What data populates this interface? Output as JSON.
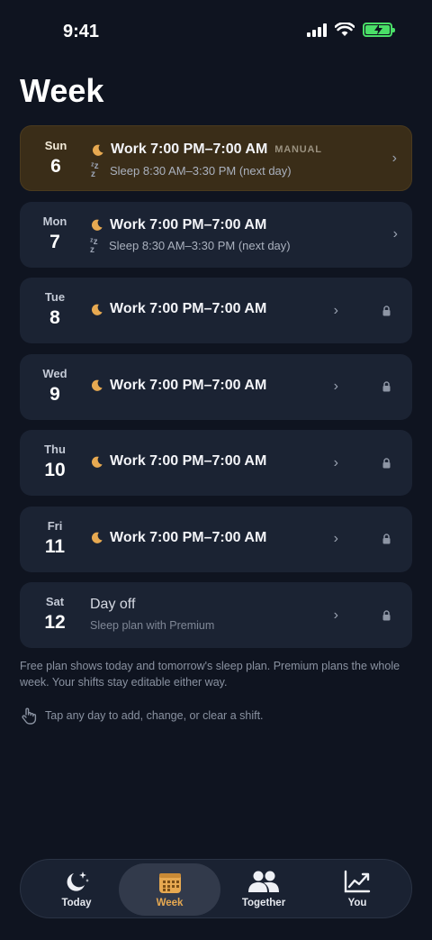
{
  "status": {
    "time": "9:41"
  },
  "page": {
    "title": "Week"
  },
  "days": [
    {
      "dow": "Sun",
      "date": "6",
      "shift": "Work 7:00 PM–7:00 AM",
      "badge": "MANUAL",
      "sleep": "Sleep 8:30 AM–3:30 PM (next day)",
      "locked": false,
      "today": true
    },
    {
      "dow": "Mon",
      "date": "7",
      "shift": "Work 7:00 PM–7:00 AM",
      "sleep": "Sleep 8:30 AM–3:30 PM (next day)",
      "locked": false
    },
    {
      "dow": "Tue",
      "date": "8",
      "shift": "Work 7:00 PM–7:00 AM",
      "locked": true
    },
    {
      "dow": "Wed",
      "date": "9",
      "shift": "Work 7:00 PM–7:00 AM",
      "locked": true
    },
    {
      "dow": "Thu",
      "date": "10",
      "shift": "Work 7:00 PM–7:00 AM",
      "locked": true
    },
    {
      "dow": "Fri",
      "date": "11",
      "shift": "Work 7:00 PM–7:00 AM",
      "locked": true
    },
    {
      "dow": "Sat",
      "date": "12",
      "dayoff": "Day off",
      "dayoff_sub": "Sleep plan with Premium",
      "locked": true
    }
  ],
  "footnote": "Free plan shows today and tomorrow's sleep plan. Premium plans the whole week. Your shifts stay editable either way.",
  "tip": "Tap any day to add, change, or clear a shift.",
  "tabs": [
    {
      "label": "Today",
      "icon": "moon-stars-icon"
    },
    {
      "label": "Week",
      "icon": "calendar-icon",
      "active": true
    },
    {
      "label": "Together",
      "icon": "people-icon"
    },
    {
      "label": "You",
      "icon": "chart-icon"
    }
  ],
  "colors": {
    "background": "#0f1420",
    "card": "#1b2333",
    "today_card": "#3a2d18",
    "accent": "#e7a951",
    "battery": "#4ade67"
  }
}
